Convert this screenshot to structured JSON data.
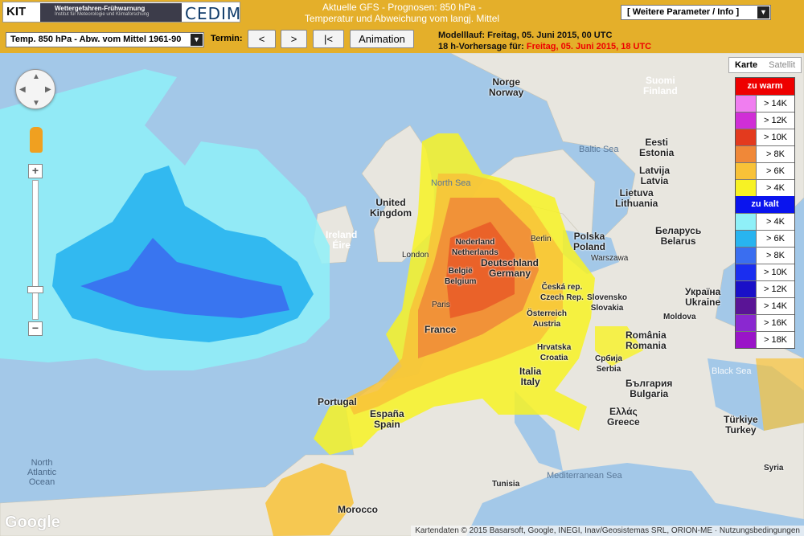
{
  "header": {
    "logo_kit": "KIT",
    "logo_storm": "Wettergefahren-Frühwarnung",
    "logo_storm_sub": "Institut für Meteorologie und Klimaforschung",
    "logo_cedim": "CEDIM",
    "title_line1": "Aktuelle GFS - Prognosen: 850 hPa -",
    "title_line2": "Temperatur und Abweichung vom langj. Mittel",
    "more_select": "[ Weitere Parameter / Info ]"
  },
  "toolbar": {
    "param_select": "Temp. 850 hPa - Abw. vom Mittel 1961-90",
    "termin_label": "Termin:",
    "prev": "<",
    "next": ">",
    "first": "|<",
    "animation": "Animation",
    "run_label": "Modelllauf: Freitag, 05. Juni 2015, 00 UTC",
    "forecast_label": "18 h-Vorhersage für:",
    "forecast_value": "Freitag, 05. Juni 2015, 18 UTC"
  },
  "maptype": {
    "map": "Karte",
    "satellite": "Satellit"
  },
  "legend": {
    "warm_header": "zu warm",
    "warm": [
      {
        "label": "> 14K",
        "color": "#f07ef0"
      },
      {
        "label": "> 12K",
        "color": "#d02ed6"
      },
      {
        "label": "> 10K",
        "color": "#e33a1e"
      },
      {
        "label": "> 8K",
        "color": "#f08838"
      },
      {
        "label": "> 6K",
        "color": "#f8c238"
      },
      {
        "label": "> 4K",
        "color": "#f7f224"
      }
    ],
    "cold_header": "zu kalt",
    "cold": [
      {
        "label": "> 4K",
        "color": "#8ff0f8"
      },
      {
        "label": "> 6K",
        "color": "#28b4f0"
      },
      {
        "label": "> 8K",
        "color": "#3a6ef0"
      },
      {
        "label": "> 10K",
        "color": "#1a2ef0"
      },
      {
        "label": "> 12K",
        "color": "#1a10c8"
      },
      {
        "label": "> 14K",
        "color": "#5a1496"
      },
      {
        "label": "> 16K",
        "color": "#8a28d0"
      },
      {
        "label": "> 18K",
        "color": "#9a14c8"
      }
    ]
  },
  "map": {
    "countries": [
      {
        "name": "Norge\nNorway"
      },
      {
        "name": "Suomi\nFinland"
      },
      {
        "name": "Eesti\nEstonia"
      },
      {
        "name": "Latvija\nLatvia"
      },
      {
        "name": "Lietuva\nLithuania"
      },
      {
        "name": "Беларусь\nBelarus"
      },
      {
        "name": "Polska\nPoland"
      },
      {
        "name": "United\nKingdom"
      },
      {
        "name": "Ireland\nÉire"
      },
      {
        "name": "Nederland\nNetherlands"
      },
      {
        "name": "België\nBelgium"
      },
      {
        "name": "Deutschland\nGermany"
      },
      {
        "name": "Česká rep.\nCzech Rep."
      },
      {
        "name": "Slovensko\nSlovakia"
      },
      {
        "name": "Österreich\nAustria"
      },
      {
        "name": "France"
      },
      {
        "name": "Hrvatska\nCroatia"
      },
      {
        "name": "Србија\nSerbia"
      },
      {
        "name": "România\nRomania"
      },
      {
        "name": "Україна\nUkraine"
      },
      {
        "name": "Moldova"
      },
      {
        "name": "България\nBulgaria"
      },
      {
        "name": "Italia\nItaly"
      },
      {
        "name": "Ελλάς\nGreece"
      },
      {
        "name": "Türkiye\nTurkey"
      },
      {
        "name": "Portugal"
      },
      {
        "name": "España\nSpain"
      },
      {
        "name": "Tunisia"
      },
      {
        "name": "Morocco"
      },
      {
        "name": "Syria"
      }
    ],
    "seas": [
      "Baltic Sea",
      "North Sea",
      "Black Sea",
      "Mediterranean Sea",
      "North\nAtlantic\nOcean"
    ],
    "cities": [
      "London",
      "Paris",
      "Berlin",
      "Warszawa"
    ],
    "google": "Google",
    "attribution": "Kartendaten © 2015 Basarsoft, Google, INEGI, Inav/Geosistemas SRL, ORION-ME  ·  Nutzungsbedingungen"
  }
}
